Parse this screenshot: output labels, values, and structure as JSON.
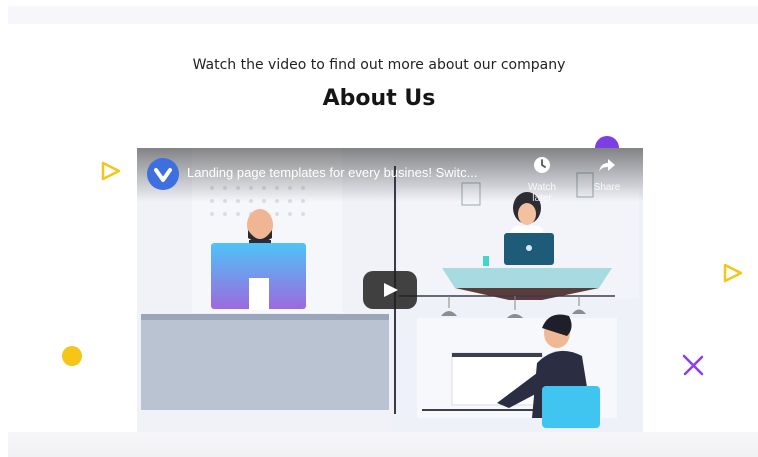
{
  "section": {
    "subtitle": "Watch the video to find out more about our company",
    "title": "About Us"
  },
  "video": {
    "title": "Landing page templates for every busines! Switc...",
    "watch_later_label": "Watch later",
    "share_label": "Share",
    "icons": {
      "channel": "channel-logo-icon",
      "watch_later": "clock-icon",
      "share": "share-arrow-icon",
      "play": "play-icon"
    }
  },
  "decorations": [
    "triangle-outline-yellow",
    "circle-purple",
    "triangle-outline-yellow",
    "circle-yellow",
    "cross-purple"
  ],
  "colors": {
    "accent_yellow": "#f5c518",
    "accent_purple": "#7b3fe4",
    "monitor_gradient_top": "#4fc3f7",
    "monitor_gradient_bottom": "#9c6ade",
    "chair_blue": "#3fc5f0"
  }
}
